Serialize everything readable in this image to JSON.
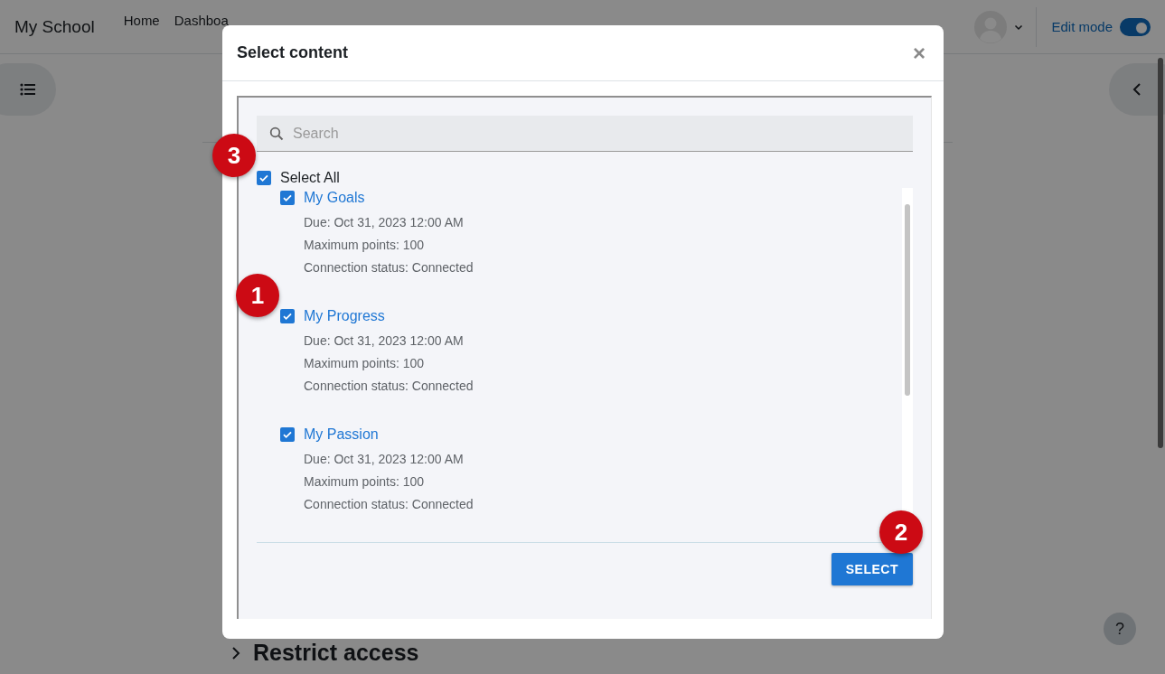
{
  "header": {
    "brand": "My School",
    "nav": [
      {
        "label": "Home"
      },
      {
        "label": "Dashboa"
      }
    ],
    "edit_mode": {
      "label": "Edit mode",
      "on": true
    }
  },
  "page": {
    "section_title": "Restrict access",
    "help": "?"
  },
  "dialog": {
    "title": "Select content",
    "close": "×",
    "search": {
      "placeholder": "Search"
    },
    "select_all": {
      "label": "Select All",
      "checked": true
    },
    "items": [
      {
        "title": "My Goals",
        "checked": true,
        "details": [
          "Due: Oct 31, 2023 12:00 AM",
          "Maximum points: 100",
          "Connection status: Connected"
        ]
      },
      {
        "title": "My Progress",
        "checked": true,
        "details": [
          "Due: Oct 31, 2023 12:00 AM",
          "Maximum points: 100",
          "Connection status: Connected"
        ]
      },
      {
        "title": "My Passion",
        "checked": true,
        "details": [
          "Due: Oct 31, 2023 12:00 AM",
          "Maximum points: 100",
          "Connection status: Connected"
        ]
      }
    ],
    "action": "SELECT"
  },
  "annotations": [
    {
      "label": "3"
    },
    {
      "label": "1"
    },
    {
      "label": "2"
    }
  ]
}
